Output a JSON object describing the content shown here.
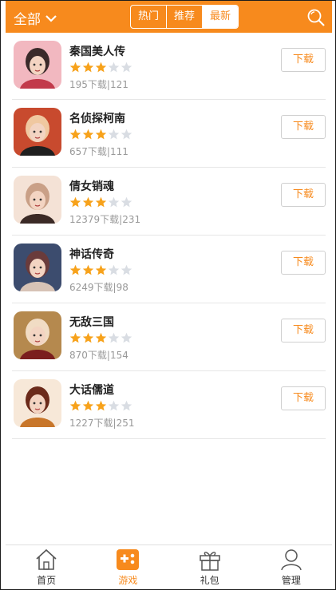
{
  "header": {
    "filter_label": "全部",
    "tabs": [
      {
        "label": "热门",
        "active": false
      },
      {
        "label": "推荐",
        "active": false
      },
      {
        "label": "最新",
        "active": true
      }
    ]
  },
  "games": [
    {
      "title": "秦国美人传",
      "rating": 3,
      "downloads": "195下载|121",
      "download_label": "下载",
      "icon_colors": [
        "#f2b8c0",
        "#c23a4b",
        "#3a2a2a"
      ]
    },
    {
      "title": "名侦探柯南",
      "rating": 3,
      "downloads": "657下载|111",
      "download_label": "下载",
      "icon_colors": [
        "#c84a2e",
        "#1f1f1f",
        "#f0c8a0"
      ]
    },
    {
      "title": "倩女销魂",
      "rating": 3,
      "downloads": "12379下载|231",
      "download_label": "下载",
      "icon_colors": [
        "#f4e2d6",
        "#3b2a26",
        "#c9a087"
      ]
    },
    {
      "title": "神话传奇",
      "rating": 3,
      "downloads": "6249下载|98",
      "download_label": "下载",
      "icon_colors": [
        "#3c4c6e",
        "#d7c3b6",
        "#6a3b3b"
      ]
    },
    {
      "title": "无敌三国",
      "rating": 3,
      "downloads": "870下载|154",
      "download_label": "下载",
      "icon_colors": [
        "#b5894e",
        "#7b1e1e",
        "#f1dcc4"
      ]
    },
    {
      "title": "大话儒道",
      "rating": 3,
      "downloads": "1227下载|251",
      "download_label": "下载",
      "icon_colors": [
        "#f7e8d8",
        "#c8762a",
        "#6b2a1a"
      ]
    }
  ],
  "bottom_nav": [
    {
      "label": "首页",
      "icon": "home-icon",
      "active": false
    },
    {
      "label": "游戏",
      "icon": "gamepad-icon",
      "active": true
    },
    {
      "label": "礼包",
      "icon": "gift-icon",
      "active": false
    },
    {
      "label": "管理",
      "icon": "user-icon",
      "active": false
    }
  ],
  "colors": {
    "accent": "#f78a1d",
    "star_on": "#f7a21b",
    "star_off": "#d9dde3"
  }
}
